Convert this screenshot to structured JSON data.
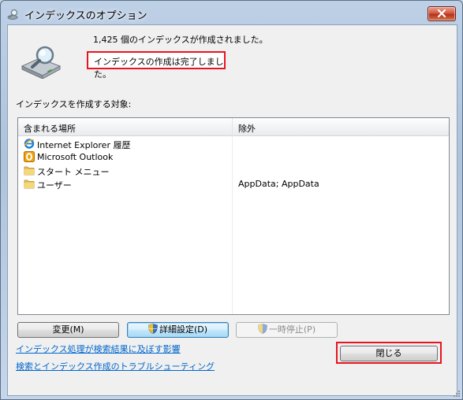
{
  "window": {
    "title": "インデックスのオプション",
    "close_icon": "close-icon"
  },
  "summary": {
    "count_text": "1,425 個のインデックスが作成されました。",
    "status_text": "インデックスの作成は完了しました。",
    "list_label": "インデックスを作成する対象:"
  },
  "table": {
    "columns": [
      "含まれる場所",
      "除外"
    ],
    "rows": [
      {
        "icon": "internet-explorer-icon",
        "name": "Internet Explorer 履歴",
        "exclude": ""
      },
      {
        "icon": "outlook-icon",
        "name": "Microsoft Outlook",
        "exclude": ""
      },
      {
        "icon": "folder-icon",
        "name": "スタート メニュー",
        "exclude": ""
      },
      {
        "icon": "folder-icon",
        "name": "ユーザー",
        "exclude": "AppData; AppData"
      }
    ]
  },
  "buttons": {
    "modify": "変更(M)",
    "advanced": "詳細設定(D)",
    "pause": "一時停止(P)",
    "close": "閉じる"
  },
  "links": {
    "effect": "インデックス処理が検索結果に及ぼす影響",
    "troubleshoot": "検索とインデックス作成のトラブルシューティング"
  },
  "colors": {
    "highlight": "#e8141f",
    "link": "#0066cc"
  }
}
